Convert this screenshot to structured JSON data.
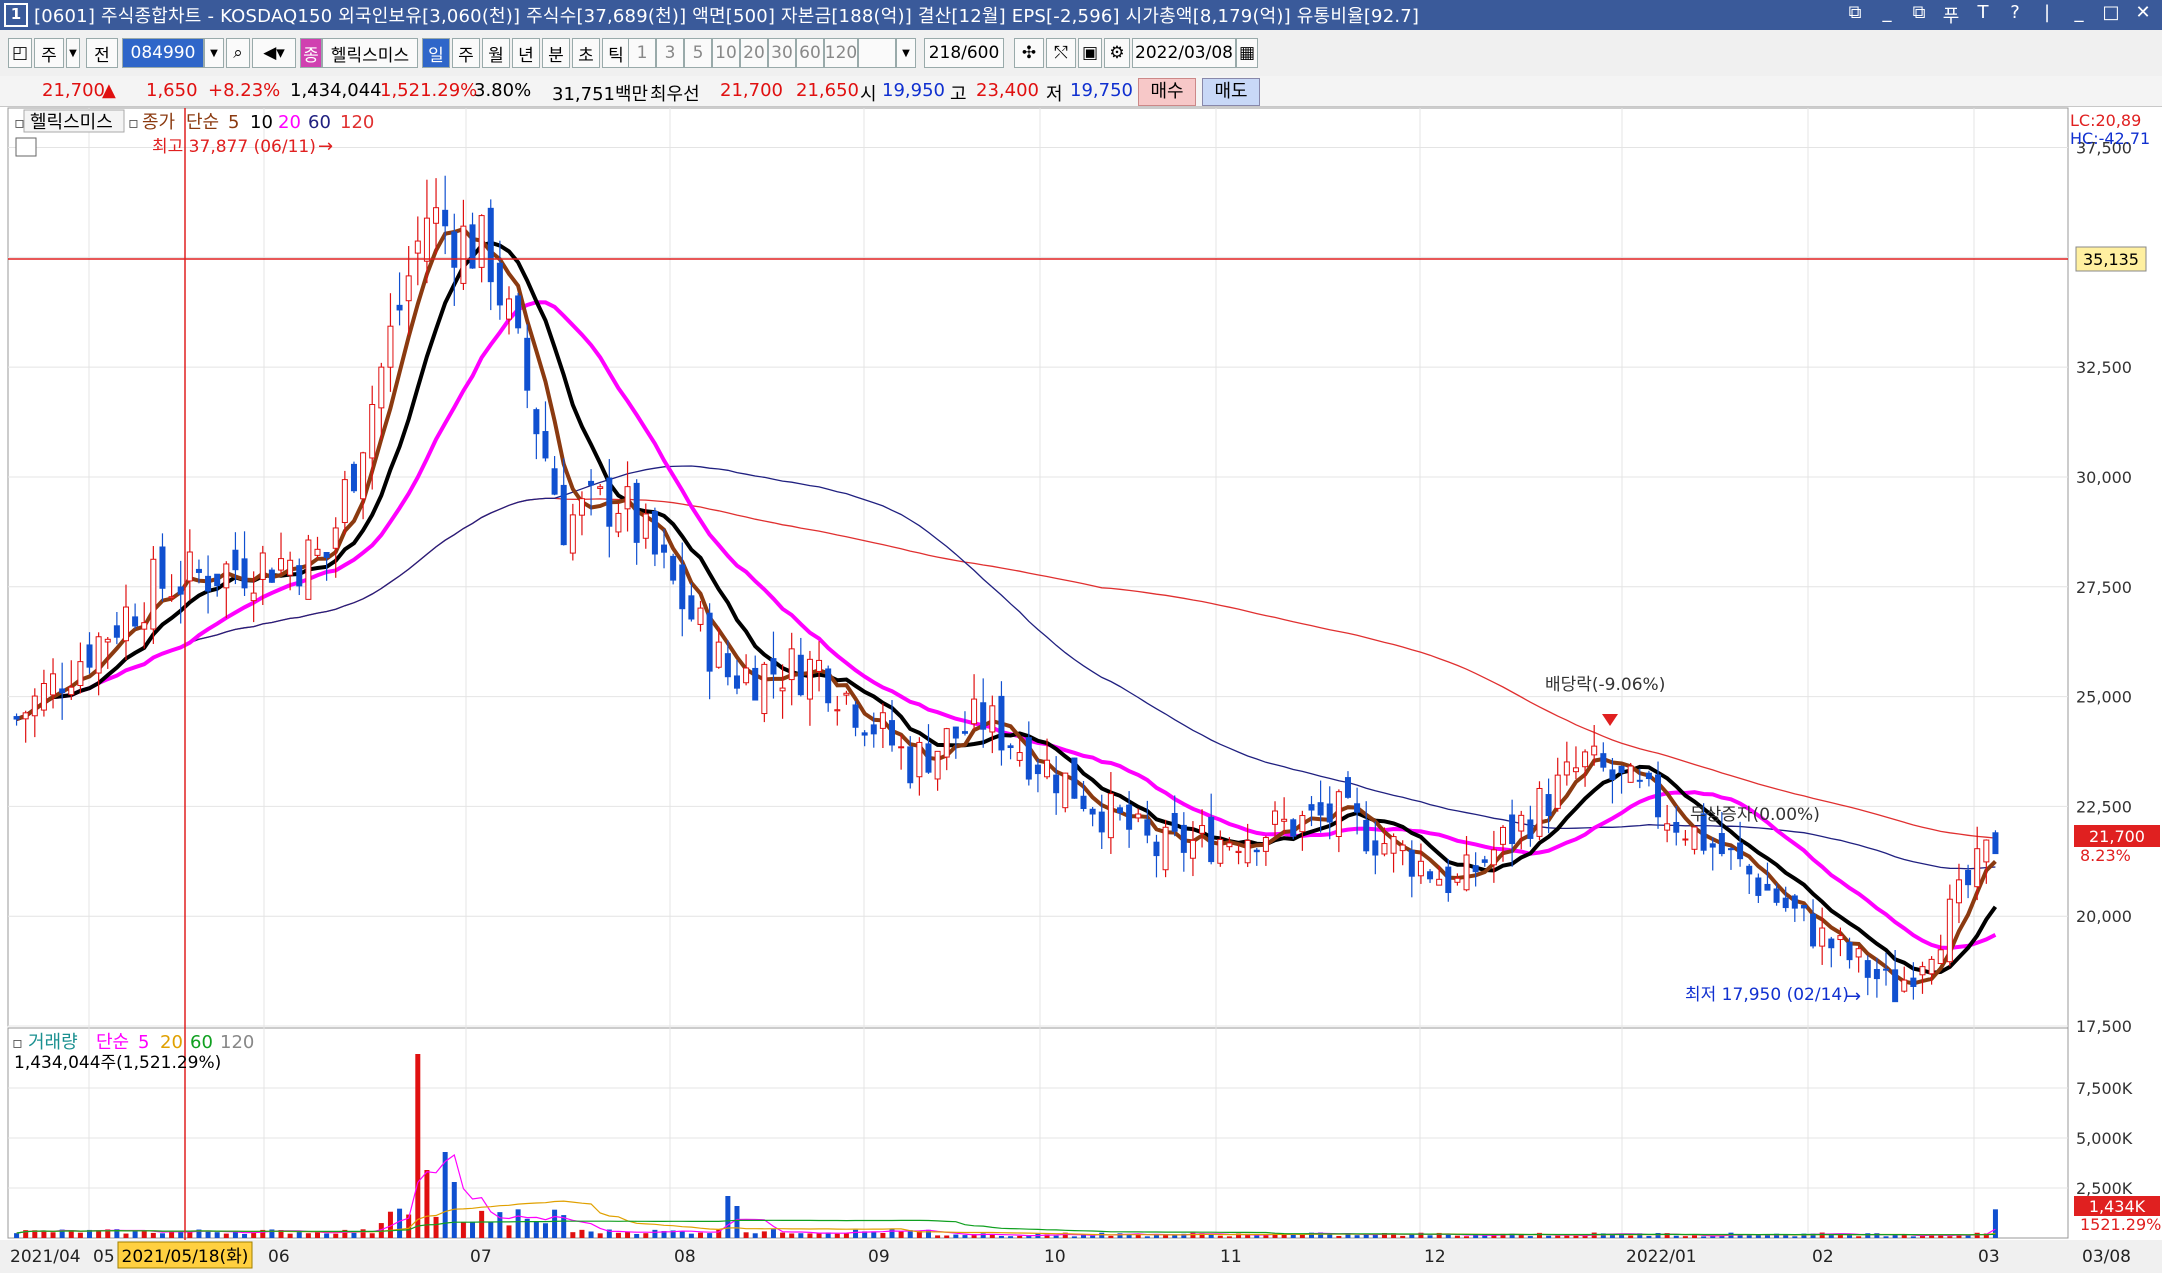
{
  "window": {
    "number": "1",
    "title": "[0601] 주식종합차트 - KOSDAQ150 외국인보유[3,060(천)] 주식수[37,689(천)] 액면[500] 자본금[188(억)] 결산[12월] EPS[-2,596] 시가총액[8,179(억)] 유통비율[92.7]",
    "controls": [
      "⧉",
      "_",
      "⧉",
      "푸",
      "T",
      "?",
      "|",
      "_",
      "□",
      "✕"
    ]
  },
  "toolbar": {
    "period_main": "주",
    "prev": "전",
    "code": "084990",
    "stock_tag": "종",
    "stock_name": "헬릭스미스",
    "periods": [
      "일",
      "주",
      "월",
      "년",
      "분",
      "초",
      "틱"
    ],
    "selected_period": "일",
    "intervals": [
      "1",
      "3",
      "5",
      "10",
      "20",
      "30",
      "60",
      "120"
    ],
    "count": "218/600",
    "date": "2022/03/08"
  },
  "quote": {
    "price": "21,700",
    "change": "1,650",
    "change_pct": "+8.23%",
    "volume": "1,434,044",
    "volume_pct": "1,521.29%",
    "turnover": "3.80%",
    "amount": "31,751백만",
    "best_label": "최우선",
    "ask": "21,700",
    "bid": "21,650",
    "open_label": "시",
    "open": "19,950",
    "high_label": "고",
    "high": "23,400",
    "low_label": "저",
    "low": "19,750",
    "buy_label": "매수",
    "sell_label": "매도"
  },
  "price_panel": {
    "legend_name": "헬릭스미스",
    "legend_type": "종가",
    "legend_method": "단순",
    "ma_periods": [
      "5",
      "10",
      "20",
      "60",
      "120"
    ],
    "lc": "LC:20,89",
    "hc": "HC:-42.71",
    "high_annot": "최고 37,877 (06/11)",
    "low_annot": "최저 17,950 (02/14)",
    "dividend_annot": "배당락(-9.06%)",
    "rights_annot": "무상증자(0.00%)",
    "hline_value": "35,135",
    "current_price_tag": "21,700",
    "current_pct_tag": "8.23%"
  },
  "volume_panel": {
    "legend_name": "거래량",
    "legend_method": "단순",
    "ma_periods": [
      "5",
      "20",
      "60",
      "120"
    ],
    "value_text": "1,434,044주(1,521.29%)",
    "current_tag": "1,434K",
    "current_pct": "1521.29%"
  },
  "x_axis": {
    "cursor_date": "2021/05/18(화)",
    "labels": [
      "2021/04",
      "05",
      "06",
      "07",
      "08",
      "09",
      "10",
      "11",
      "12",
      "2022/01",
      "02",
      "03",
      "03/08"
    ]
  },
  "colors": {
    "up": "#e01010",
    "down": "#1050d0",
    "ma5": "#8b3a10",
    "ma10": "#000000",
    "ma20": "#ff00ff",
    "ma60": "#202080",
    "ma120": "#e03030"
  },
  "chart_data": {
    "type": "candlestick",
    "y_range": [
      17500,
      38400
    ],
    "y_ticks": [
      "37,500",
      "35,000",
      "32,500",
      "30,000",
      "27,500",
      "25,000",
      "22,500",
      "20,000",
      "17,500"
    ],
    "volume_range": [
      0,
      10000
    ],
    "volume_ticks": [
      "7,500K",
      "5,000K",
      "2,500K"
    ],
    "approx_close_path": [
      {
        "date": "2021/04",
        "close": 24500
      },
      {
        "date": "2021/04 late",
        "close": 27500
      },
      {
        "date": "2021/05",
        "close": 28000
      },
      {
        "date": "2021/05/18",
        "close": 28200
      },
      {
        "date": "2021/06/11",
        "close": 36000
      },
      {
        "date": "2021/06 mid",
        "close": 35000
      },
      {
        "date": "2021/06 late",
        "close": 29000
      },
      {
        "date": "2021/07",
        "close": 29500
      },
      {
        "date": "2021/07 late",
        "close": 25500
      },
      {
        "date": "2021/08",
        "close": 25700
      },
      {
        "date": "2021/08 late",
        "close": 23500
      },
      {
        "date": "2021/09",
        "close": 24500
      },
      {
        "date": "2021/10",
        "close": 21500
      },
      {
        "date": "2021/11",
        "close": 22300
      },
      {
        "date": "2021/11 late",
        "close": 20700
      },
      {
        "date": "2021/12",
        "close": 23500
      },
      {
        "date": "2022/01",
        "close": 22500
      },
      {
        "date": "2022/01 late",
        "close": 21300
      },
      {
        "date": "2022/02",
        "close": 19500
      },
      {
        "date": "2022/02/14",
        "close": 18300
      },
      {
        "date": "2022/03",
        "close": 20000
      },
      {
        "date": "2022/03/08",
        "close": 21700
      }
    ]
  }
}
